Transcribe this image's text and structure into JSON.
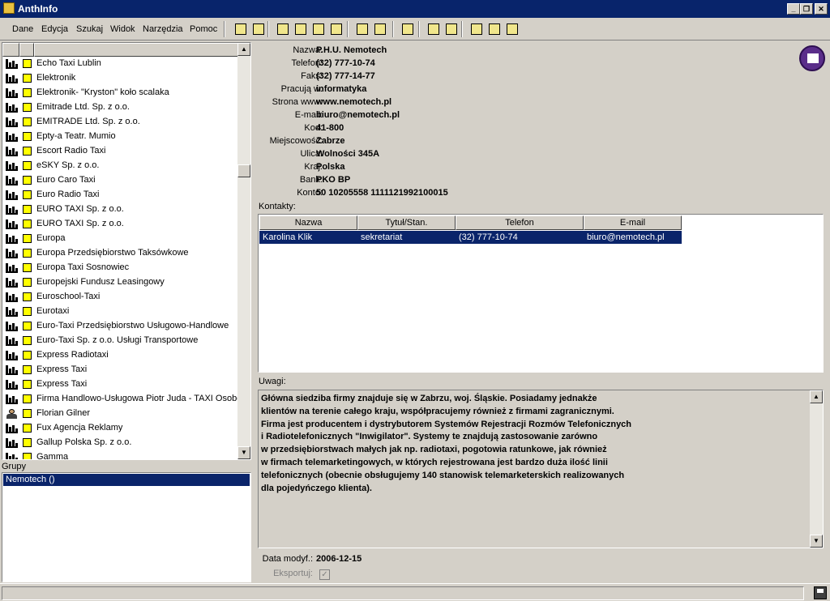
{
  "window": {
    "title": "AnthInfo",
    "controls": [
      "_",
      "❐",
      "✕"
    ]
  },
  "menu": {
    "items": [
      "Dane",
      "Edycja",
      "Szukaj",
      "Widok",
      "Narzędzia",
      "Pomoc"
    ]
  },
  "toolbar": {
    "buttons": [
      {
        "name": "copy-icon"
      },
      {
        "name": "print-icon"
      },
      {
        "name": "new-record-icon"
      },
      {
        "name": "edit-record-icon"
      },
      {
        "name": "move-record-icon"
      },
      {
        "name": "delete-record-icon"
      },
      {
        "name": "pin-icon"
      },
      {
        "name": "pin-search-icon"
      },
      {
        "name": "swap-icon"
      },
      {
        "name": "check-icon"
      },
      {
        "name": "window-icon"
      },
      {
        "name": "phone-icon"
      },
      {
        "name": "mail-icon"
      },
      {
        "name": "calculator-icon"
      }
    ]
  },
  "company_list": [
    {
      "label": "Echo Taxi Lublin",
      "icon": "company"
    },
    {
      "label": "Elektronik",
      "icon": "company"
    },
    {
      "label": "Elektronik- \"Kryston\" koło scalaka",
      "icon": "company"
    },
    {
      "label": "Emitrade Ltd. Sp. z o.o.",
      "icon": "company"
    },
    {
      "label": "EMITRADE Ltd. Sp. z o.o.",
      "icon": "company"
    },
    {
      "label": "Epty-a Teatr. Mumio",
      "icon": "company"
    },
    {
      "label": "Escort Radio Taxi",
      "icon": "company"
    },
    {
      "label": "eSKY Sp. z o.o.",
      "icon": "company"
    },
    {
      "label": "Euro Caro Taxi",
      "icon": "company"
    },
    {
      "label": "Euro Radio Taxi",
      "icon": "company"
    },
    {
      "label": "EURO TAXI Sp. z o.o.",
      "icon": "company"
    },
    {
      "label": "EURO TAXI Sp. z o.o.",
      "icon": "company"
    },
    {
      "label": "Europa",
      "icon": "company"
    },
    {
      "label": "Europa Przedsiębiorstwo Taksówkowe",
      "icon": "company"
    },
    {
      "label": "Europa Taxi Sosnowiec",
      "icon": "company"
    },
    {
      "label": "Europejski Fundusz Leasingowy",
      "icon": "company"
    },
    {
      "label": "Euroschool-Taxi",
      "icon": "company"
    },
    {
      "label": "Eurotaxi",
      "icon": "company"
    },
    {
      "label": "Euro-Taxi Przedsiębiorstwo Usługowo-Handlowe",
      "icon": "company"
    },
    {
      "label": "Euro-Taxi Sp. z o.o. Usługi Transportowe",
      "icon": "company"
    },
    {
      "label": "Express Radiotaxi",
      "icon": "company"
    },
    {
      "label": "Express Taxi",
      "icon": "company"
    },
    {
      "label": "Express Taxi",
      "icon": "company"
    },
    {
      "label": "Firma Handlowo-Usługowa Piotr Juda - TAXI Osobo",
      "icon": "company"
    },
    {
      "label": "Florian Gilner",
      "icon": "person"
    },
    {
      "label": "Fux Agencja Reklamy",
      "icon": "company"
    },
    {
      "label": "Gallup Polska Sp. z o.o.",
      "icon": "company"
    },
    {
      "label": "Gamma",
      "icon": "company"
    }
  ],
  "groups": {
    "label": "Grupy",
    "items": [
      "Nemotech ()"
    ]
  },
  "details": {
    "fields": [
      {
        "label": "Nazwa:",
        "value": "P.H.U. Nemotech"
      },
      {
        "label": "Telefon:",
        "value": "(32) 777-10-74"
      },
      {
        "label": "Faks:",
        "value": "(32) 777-14-77"
      },
      {
        "label": "Pracują w:",
        "value": "informatyka"
      },
      {
        "label": "Strona www:",
        "value": "www.nemotech.pl"
      },
      {
        "label": "E-mail:",
        "value": "biuro@nemotech.pl"
      },
      {
        "label": "Kod:",
        "value": "41-800"
      },
      {
        "label": "Miejscowość:",
        "value": "Zabrze"
      },
      {
        "label": "Ulica:",
        "value": "Wolności 345A"
      },
      {
        "label": "Kraj:",
        "value": "Polska"
      },
      {
        "label": "Bank:",
        "value": "PKO BP"
      },
      {
        "label": "Konto:",
        "value": "50 10205558 1111121992100015"
      }
    ]
  },
  "contacts": {
    "label": "Kontakty:",
    "columns": [
      "Nazwa",
      "Tytuł/Stan.",
      "Telefon",
      "E-mail"
    ],
    "rows": [
      [
        "Karolina Klik",
        "sekretariat",
        "(32) 777-10-74",
        "biuro@nemotech.pl"
      ]
    ]
  },
  "notes": {
    "label": "Uwagi:",
    "text": "Główna siedziba firmy znajduje się w Zabrzu, woj. Śląskie. Posiadamy jednakże\nklientów na terenie całego kraju, współpracujemy również z firmami zagranicznymi.\nFirma jest producentem i dystrybutorem Systemów Rejestracji Rozmów Telefonicznych\ni Radiotelefonicznych \"Inwigilator\". Systemy te znajdują zastosowanie zarówno\nw przedsiębiorstwach małych jak np. radiotaxi, pogotowia ratunkowe, jak również\nw firmach telemarketingowych, w których rejestrowana jest bardzo duża ilość linii\ntelefonicznych (obecnie obsługujemy 140 stanowisk telemarketerskich realizowanych\ndla pojedyńczego klienta)."
  },
  "meta": {
    "modified_label": "Data modyf.:",
    "modified_value": "2006-12-15",
    "export_label": "Eksportuj:",
    "export_checked": "✓"
  },
  "colors": {
    "titlebar": "#08246b",
    "selection": "#0a246a",
    "window": "#d4d0c8"
  }
}
